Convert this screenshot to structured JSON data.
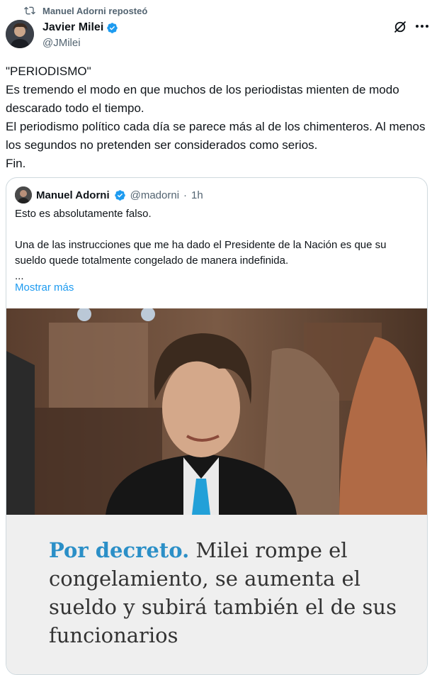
{
  "repost": {
    "label": "Manuel Adorni reposteó",
    "icon": "repost-icon"
  },
  "author": {
    "name": "Javier Milei",
    "handle": "@JMilei"
  },
  "tweet": {
    "text": "\"PERIODISMO\"\nEs tremendo el modo en que muchos de los periodistas mienten de modo descarado todo el tiempo.\nEl periodismo político cada día se parece más al de los chimenteros. Al menos los segundos no pretenden ser considerados como serios.\nFin."
  },
  "quote": {
    "name": "Manuel Adorni",
    "handle": "@madorni",
    "separator": "·",
    "time": "1h",
    "text": "Esto es absolutamente falso.\n\nUna de las instrucciones que me ha dado el Presidente de la Nación es que su sueldo quede totalmente congelado de manera indefinida.\n...",
    "show_more": "Mostrar más",
    "headline_accent": "Por decreto.",
    "headline_rest": " Milei rompe el congelamiento, se aumenta el sueldo y subirá también el de sus funcionarios"
  },
  "colors": {
    "link": "#1d9bf0",
    "verified": "#1d9bf0",
    "headline_accent": "#2b8fc7",
    "muted": "#536471"
  }
}
